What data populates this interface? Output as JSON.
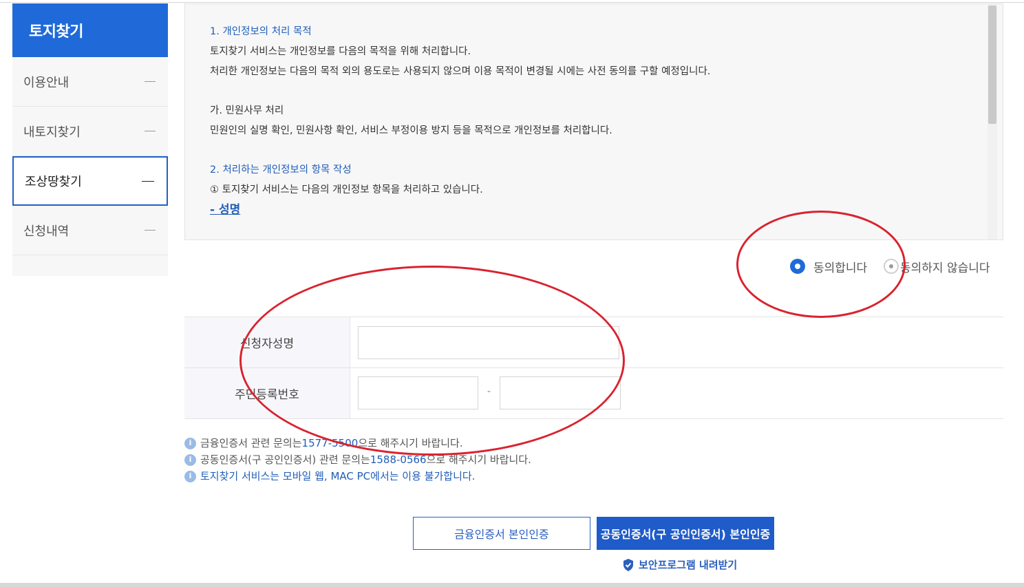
{
  "sidebar": {
    "title": "토지찾기",
    "items": [
      {
        "label": "이용안내"
      },
      {
        "label": "내토지찾기"
      },
      {
        "label": "조상땅찾기"
      },
      {
        "label": "신청내역"
      }
    ]
  },
  "privacy": {
    "heading1": "1. 개인정보의 처리 목적",
    "p1": "토지찾기 서비스는 개인정보를 다음의 목적을 위해 처리합니다.",
    "p2": "처리한 개인정보는 다음의 목적 외의 용도로는 사용되지 않으며 이용 목적이 변경될 시에는 사전 동의를 구할 예정입니다.",
    "sub1": "가. 민원사무 처리",
    "p3": "민원인의 실명 확인, 민원사항 확인, 서비스 부정이용 방지 등을 목적으로 개인정보를 처리합니다.",
    "heading2": "2. 처리하는 개인정보의 항목 작성",
    "p4": "① 토지찾기 서비스는 다음의 개인정보 항목을 처리하고 있습니다.",
    "link": "- 성명"
  },
  "consent": {
    "agree": "동의합니다",
    "disagree": "동의하지 않습니다"
  },
  "form": {
    "name_label": "신청자성명",
    "rrn_label": "주민등록번호",
    "hyphen": "-"
  },
  "notes": {
    "n1_prefix": "금융인증서 관련 문의는",
    "n1_phone": "1577-5500",
    "n1_suffix": " 으로 해주시기 바랍니다.",
    "n2_prefix": "공동인증서(구 공인인증서) 관련 문의는",
    "n2_phone": "1588-0566",
    "n2_suffix": " 으로 해주시기 바랍니다.",
    "n3": "토지찾기 서비스는 모바일 웹, MAC PC에서는 이용 불가합니다.",
    "info_glyph": "i"
  },
  "buttons": {
    "financial": "금융인증서 본인인증",
    "joint": "공동인증서(구 공인인증서) 본인인증",
    "download": "보안프로그램 내려받기"
  },
  "colors": {
    "brand_blue": "#1f6ad8",
    "annotation_red": "#d9232f"
  }
}
